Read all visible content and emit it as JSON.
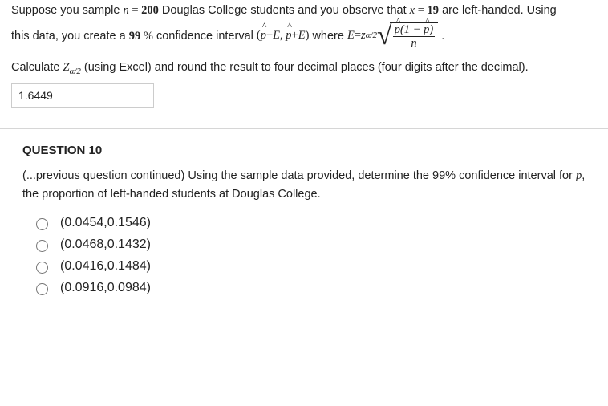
{
  "question9": {
    "line1_pre": "Suppose you sample ",
    "n_eq": "n = 200",
    "line1_mid": " Douglas College students and you observe that ",
    "x_eq": "x = 19",
    "line1_post": " are left-handed. Using",
    "line2_pre": "this data, you create a ",
    "conf_pct": "99 %",
    "line2_mid": " confidence interval ",
    "interval_tex": "(p̂ − E,  p̂ + E)",
    "where_txt": " where ",
    "E_eq_left": "E = z",
    "E_sub": "α/2",
    "frac_num": "p̂(1 − p̂)",
    "frac_den": "n",
    "period": " .",
    "instruction": "Calculate Zα/2 (using Excel) and round the result to four decimal places (four digits after the decimal).",
    "answer_value": "1.6449"
  },
  "question10": {
    "title": "QUESTION 10",
    "body": "(...previous question continued) Using the sample data provided, determine the 99% confidence interval for p, the proportion of left-handed students at Douglas College.",
    "options": [
      "(0.0454,0.1546)",
      "(0.0468,0.1432)",
      "(0.0416,0.1484)",
      "(0.0916,0.0984)"
    ]
  }
}
